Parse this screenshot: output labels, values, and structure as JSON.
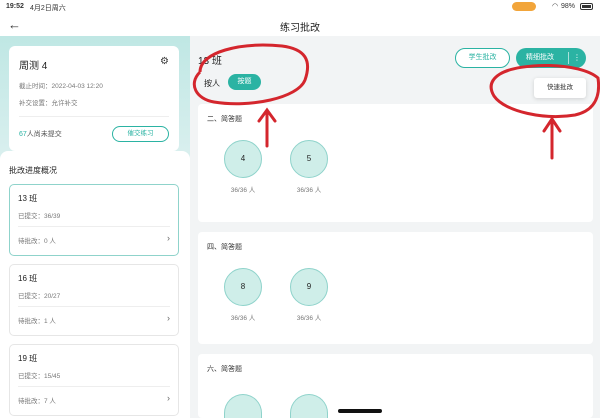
{
  "status": {
    "time": "19:52",
    "date": "4月2日周六",
    "battery": "98%"
  },
  "nav": {
    "title": "练习批改",
    "back_icon": "arrow-left-icon"
  },
  "homework": {
    "title": "周测 4",
    "deadline": "截止时间：2022-04-03 12:20",
    "makeup": "补交设置：允许补交",
    "pending_num": "67",
    "pending_text": "人尚未提交",
    "remind_label": "催交练习"
  },
  "progress": {
    "title": "批改进度概况",
    "classes": [
      {
        "name": "13 班",
        "submitted": "已提交：36/39",
        "pending": "待批改：0 人"
      },
      {
        "name": "16 班",
        "submitted": "已提交：20/27",
        "pending": "待批改：1 人"
      },
      {
        "name": "19 班",
        "submitted": "已提交：15/45",
        "pending": "待批改：7 人"
      }
    ]
  },
  "main": {
    "class_title": "13 班",
    "student_btn": "学生批改",
    "fine_btn": "精细批改",
    "more": "⋮",
    "dropdown_item": "快速批改",
    "by_label": "按人",
    "by_question": "按题",
    "sections": [
      {
        "title": "二、简答题",
        "questions": [
          {
            "num": "4",
            "count": "36/36 人"
          },
          {
            "num": "5",
            "count": "36/36 人"
          }
        ]
      },
      {
        "title": "四、简答题",
        "questions": [
          {
            "num": "8",
            "count": "36/36 人"
          },
          {
            "num": "9",
            "count": "36/36 人"
          }
        ]
      },
      {
        "title": "六、简答题",
        "questions": []
      }
    ]
  },
  "colors": {
    "accent": "#2bb3a3",
    "annotation": "#d4262d"
  }
}
